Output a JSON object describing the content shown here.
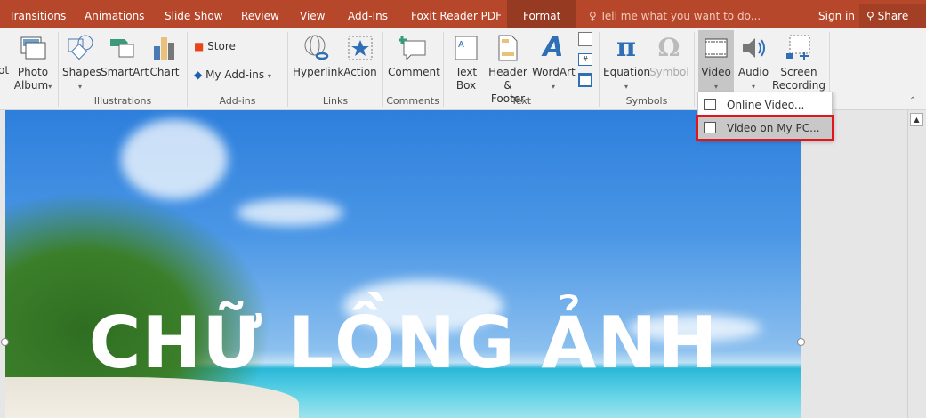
{
  "tabs": [
    "Transitions",
    "Animations",
    "Slide Show",
    "Review",
    "View",
    "Add-Ins",
    "Foxit Reader PDF",
    "Format"
  ],
  "tell_me": "Tell me what you want to do...",
  "sign_in": "Sign in",
  "share": "Share",
  "ribbon": {
    "photo_partial": "ot",
    "photo_album": [
      "Photo",
      "Album"
    ],
    "shapes": "Shapes",
    "smartart": "SmartArt",
    "chart": "Chart",
    "store": "Store",
    "my_addins": "My Add-ins",
    "hyperlink": "Hyperlink",
    "action": "Action",
    "comment": "Comment",
    "text_box": [
      "Text",
      "Box"
    ],
    "header_footer": [
      "Header",
      "& Footer"
    ],
    "wordart": "WordArt",
    "equation": "Equation",
    "symbol": "Symbol",
    "video": "Video",
    "audio": "Audio",
    "screen_recording": [
      "Screen",
      "Recording"
    ],
    "groups": [
      "Illustrations",
      "Add-ins",
      "Links",
      "Comments",
      "Text",
      "Symbols"
    ]
  },
  "video_menu": [
    "Online Video...",
    "Video on My PC..."
  ],
  "slide_title": "CHỮ LỒNG ẢNH",
  "colors": {
    "tab_bar": "#b7472a",
    "highlight": "#e0161d"
  }
}
